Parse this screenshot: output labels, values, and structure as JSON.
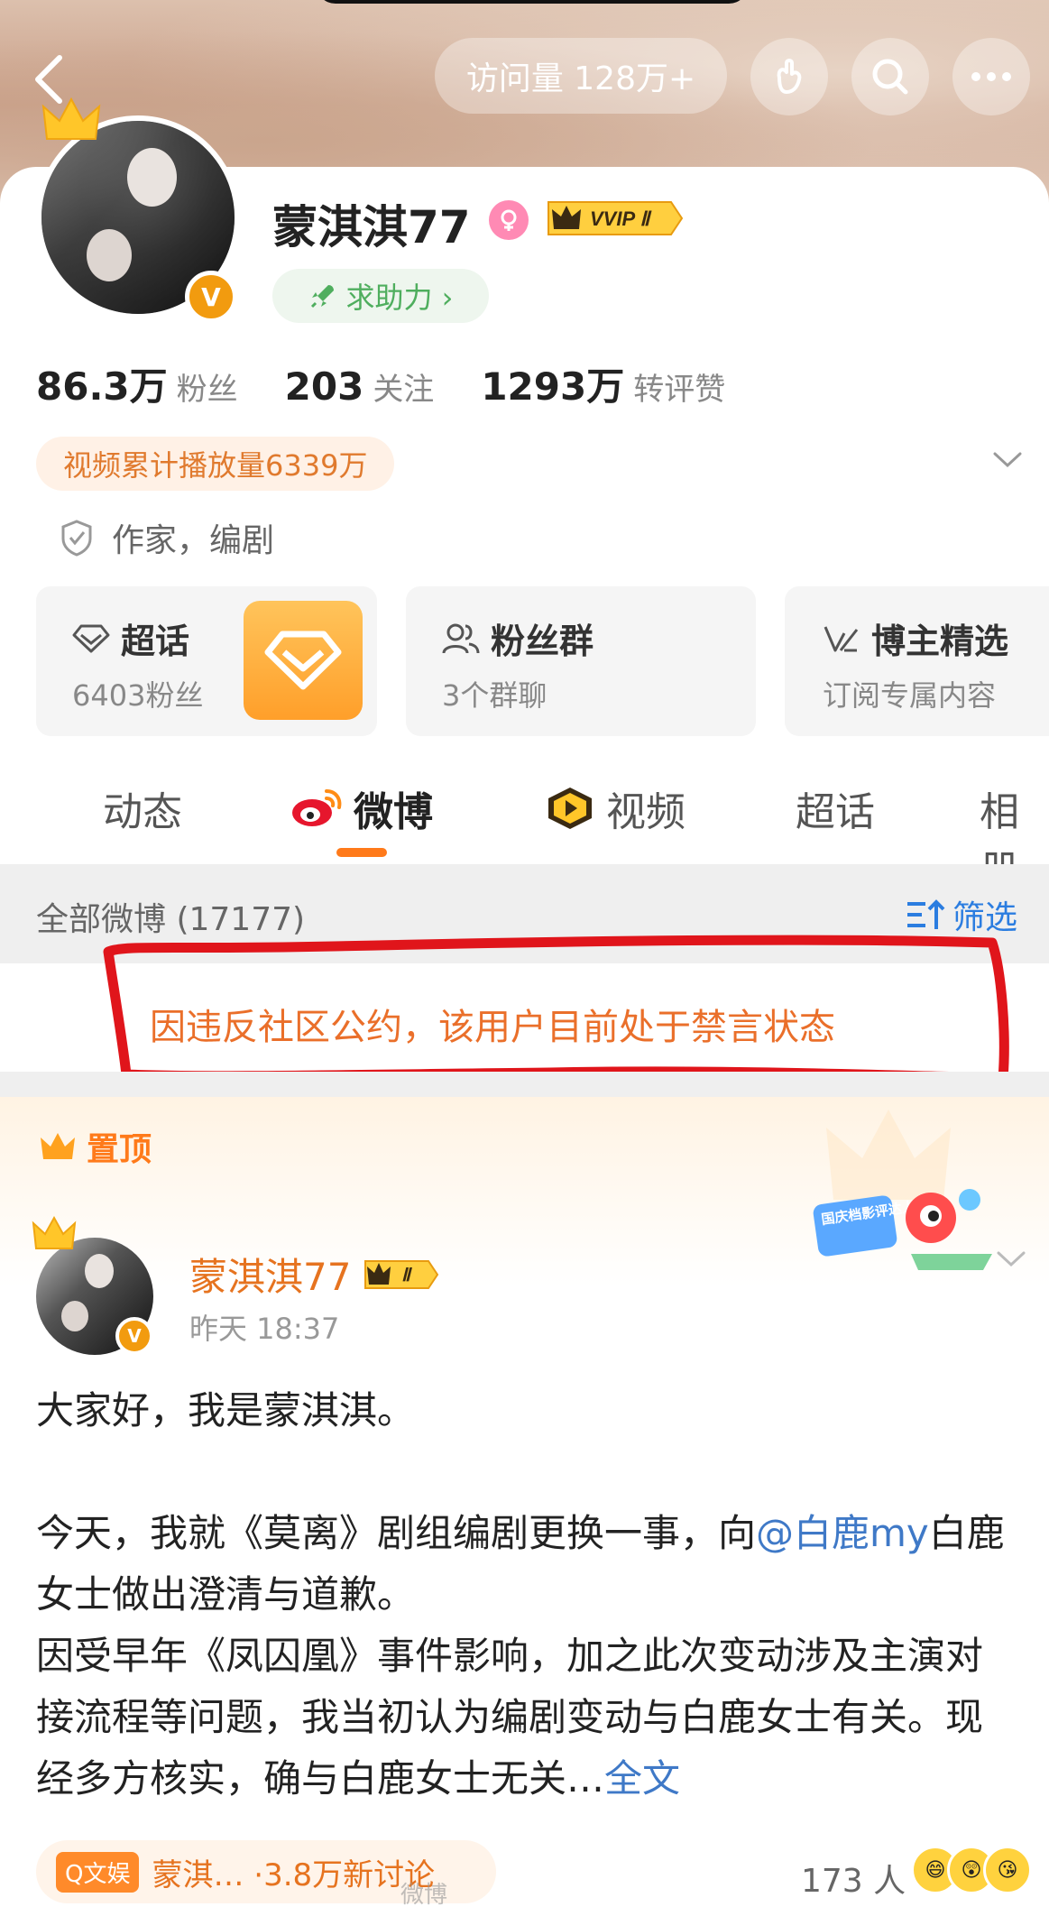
{
  "header": {
    "visit_label": "访问量 128万+"
  },
  "profile": {
    "username": "蒙淇淇77",
    "vip_label": "VVIP Ⅱ",
    "help_label": "求助力 ›",
    "stats": [
      {
        "num": "86.3万",
        "label": "粉丝"
      },
      {
        "num": "203",
        "label": "关注"
      },
      {
        "num": "1293万",
        "label": "转评赞"
      }
    ],
    "play_count": "视频累计播放量6339万",
    "occupation": "作家，编剧",
    "features": [
      {
        "title": "超话",
        "sub": "6403粉丝"
      },
      {
        "title": "粉丝群",
        "sub": "3个群聊"
      },
      {
        "title": "博主精选",
        "sub": "订阅专属内容"
      }
    ]
  },
  "tabs": [
    {
      "label": "动态"
    },
    {
      "label": "微博"
    },
    {
      "label": "视频"
    },
    {
      "label": "超话"
    },
    {
      "label": "相册"
    }
  ],
  "filter": {
    "count_label": "全部微博 (17177)",
    "filter_label": "筛选"
  },
  "ban_notice": "因违反社区公约，该用户目前处于禁言状态",
  "pinned": {
    "label": "置顶",
    "badge_text": "国庆档影评达人",
    "author": "蒙淇淇77",
    "level": "Ⅱ",
    "time": "昨天 18:37",
    "line1": "大家好，我是蒙淇淇。",
    "p2_pre": "今天，我就《莫离》剧组编剧更换一事，向",
    "p2_mention": "@白鹿my",
    "p2_post": "白鹿女士做出澄清与道歉。",
    "p3": "因受早年《凤囚凰》事件影响，加之此次变动涉及主演对接流程等问题，我当初认为编剧变动与白鹿女士有关。现经多方核实，确与白鹿女士无关…",
    "more_label": "全文"
  },
  "bottom": {
    "topic_tag": "Q文娱",
    "topic_text": "蒙淇… ·3.8万新讨论",
    "like_count": "173 人",
    "watermark": "微博"
  }
}
